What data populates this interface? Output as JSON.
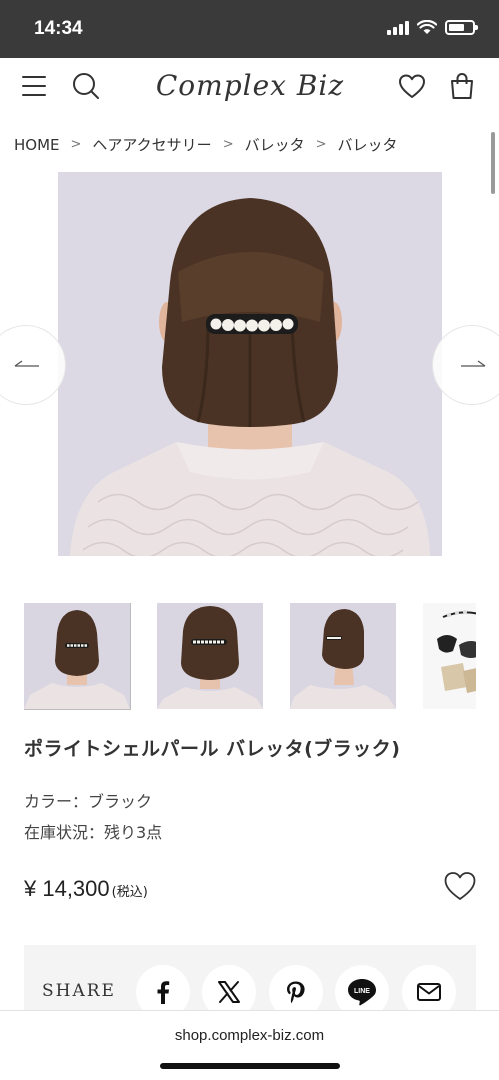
{
  "status_bar": {
    "time": "14:34"
  },
  "header": {
    "logo_text": "Complex Biz",
    "menu_icon": "hamburger-menu-icon",
    "search_icon": "search-icon",
    "favorites_icon": "heart-icon",
    "cart_icon": "shopping-bag-icon"
  },
  "breadcrumb": {
    "items": [
      "HOME",
      "ヘアアクセサリー",
      "バレッタ",
      "バレッタ"
    ],
    "separator": ">"
  },
  "gallery": {
    "prev_icon": "arrow-left-icon",
    "next_icon": "arrow-right-icon",
    "thumbnail_count_visible": 4
  },
  "product": {
    "name": "ポライトシェルパール バレッタ(ブラック)",
    "color_line": "カラー：ブラック",
    "stock_line": "在庫状況：残り3点",
    "price": "¥ 14,300",
    "tax_note": "(税込)",
    "favorite_icon": "heart-outline-icon"
  },
  "share": {
    "label": "SHARE",
    "buttons": [
      "facebook-icon",
      "x-icon",
      "pinterest-icon",
      "line-icon",
      "mail-icon"
    ],
    "line_text": "LINE"
  },
  "browser": {
    "url": "shop.complex-biz.com"
  },
  "colors": {
    "status_bar": "#3a3a3a",
    "share_bg": "#f4f4f4",
    "image_bg": "#d9d6e2"
  }
}
